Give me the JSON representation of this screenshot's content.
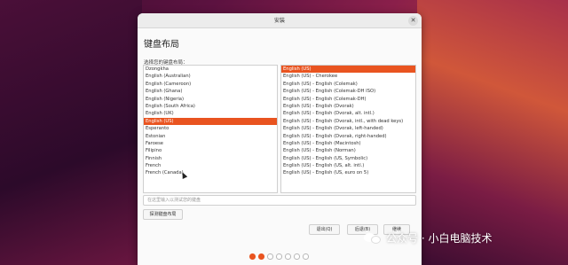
{
  "window": {
    "title": "安装",
    "page_title": "键盘布局",
    "section_label": "选择您的键盘布局："
  },
  "left_list": {
    "items": [
      "Dzongkha",
      "English (Australian)",
      "English (Cameroon)",
      "English (Ghana)",
      "English (Nigeria)",
      "English (South Africa)",
      "English (UK)",
      "English (US)",
      "Esperanto",
      "Estonian",
      "Faroese",
      "Filipino",
      "Finnish",
      "French",
      "French (Canada)"
    ],
    "selected": "English (US)"
  },
  "right_list": {
    "items": [
      "English (US)",
      "English (US) - Cherokee",
      "English (US) - English (Colemak)",
      "English (US) - English (Colemak-DH ISO)",
      "English (US) - English (Colemak-DH)",
      "English (US) - English (Dvorak)",
      "English (US) - English (Dvorak, alt. intl.)",
      "English (US) - English (Dvorak, intl., with dead keys)",
      "English (US) - English (Dvorak, left-handed)",
      "English (US) - English (Dvorak, right-handed)",
      "English (US) - English (Macintosh)",
      "English (US) - English (Norman)",
      "English (US) - English (US, Symbolic)",
      "English (US) - English (US, alt. intl.)",
      "English (US) - English (US, euro on 5)"
    ],
    "selected": "English (US)"
  },
  "test_input": {
    "placeholder": "在这里输入以测试您的键盘"
  },
  "buttons": {
    "detect": "探测键盘布局",
    "quit": "退出(Q)",
    "back": "后退(B)",
    "next": "继续"
  },
  "progress": {
    "total_steps": 7,
    "active_steps": 2
  },
  "watermark": {
    "text": "公众号 · 小白电脑技术"
  },
  "colors": {
    "accent": "#e95420"
  }
}
